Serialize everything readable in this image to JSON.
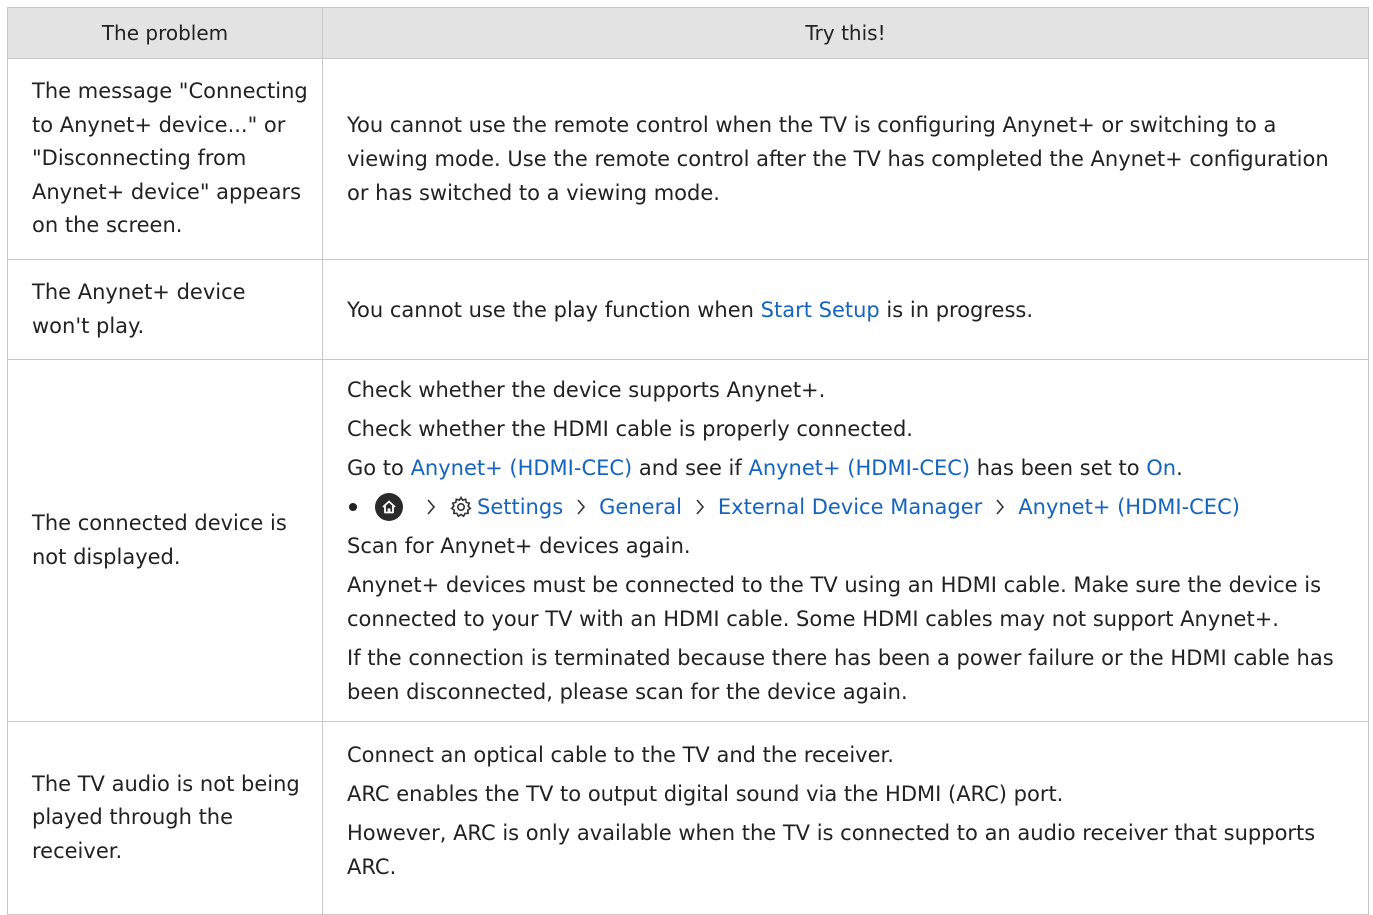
{
  "header": {
    "problem": "The problem",
    "try_this": "Try this!"
  },
  "rows": [
    {
      "problem": "The message \"Connecting to Anynet+ device...\" or \"Disconnecting from Anynet+ device\" appears on the screen.",
      "solution": "You cannot use the remote control when the TV is configuring Anynet+ or switching to a viewing mode. Use the remote control after the TV has completed the Anynet+ configuration or has switched to a viewing mode."
    },
    {
      "problem": "The Anynet+ device won't play.",
      "solution_pre": "You cannot use the play function when ",
      "solution_link": "Start Setup",
      "solution_post": " is in progress."
    },
    {
      "problem": "The connected device is not displayed.",
      "line1": "Check whether the device supports Anynet+.",
      "line2": "Check whether the HDMI cable is properly connected.",
      "line3_pre": "Go to ",
      "line3_link1": "Anynet+ (HDMI-CEC)",
      "line3_mid": " and see if ",
      "line3_link2": "Anynet+ (HDMI-CEC)",
      "line3_mid2": " has been set to ",
      "line3_link3": "On",
      "line3_post": ".",
      "path": {
        "icons": [
          "home-icon",
          "gear-icon",
          "chevron-right-icon"
        ],
        "settings": "Settings",
        "general": "General",
        "external": "External Device Manager",
        "anynet": "Anynet+ (HDMI-CEC)"
      },
      "line4": "Scan for Anynet+ devices again.",
      "line5": "Anynet+ devices must be connected to the TV using an HDMI cable. Make sure the device is connected to your TV with an HDMI cable. Some HDMI cables may not support Anynet+.",
      "line6": "If the connection is terminated because there has been a power failure or the HDMI cable has been disconnected, please scan for the device again."
    },
    {
      "problem": "The TV audio is not being played through the receiver.",
      "line1": "Connect an optical cable to the TV and the receiver.",
      "line2": "ARC enables the TV to output digital sound via the HDMI (ARC) port.",
      "line3": "However, ARC is only available when the TV is connected to an audio receiver that supports ARC."
    }
  ],
  "colors": {
    "link": "#1565c0",
    "header_bg": "#e3e3e3",
    "border": "#c8c8c8"
  }
}
